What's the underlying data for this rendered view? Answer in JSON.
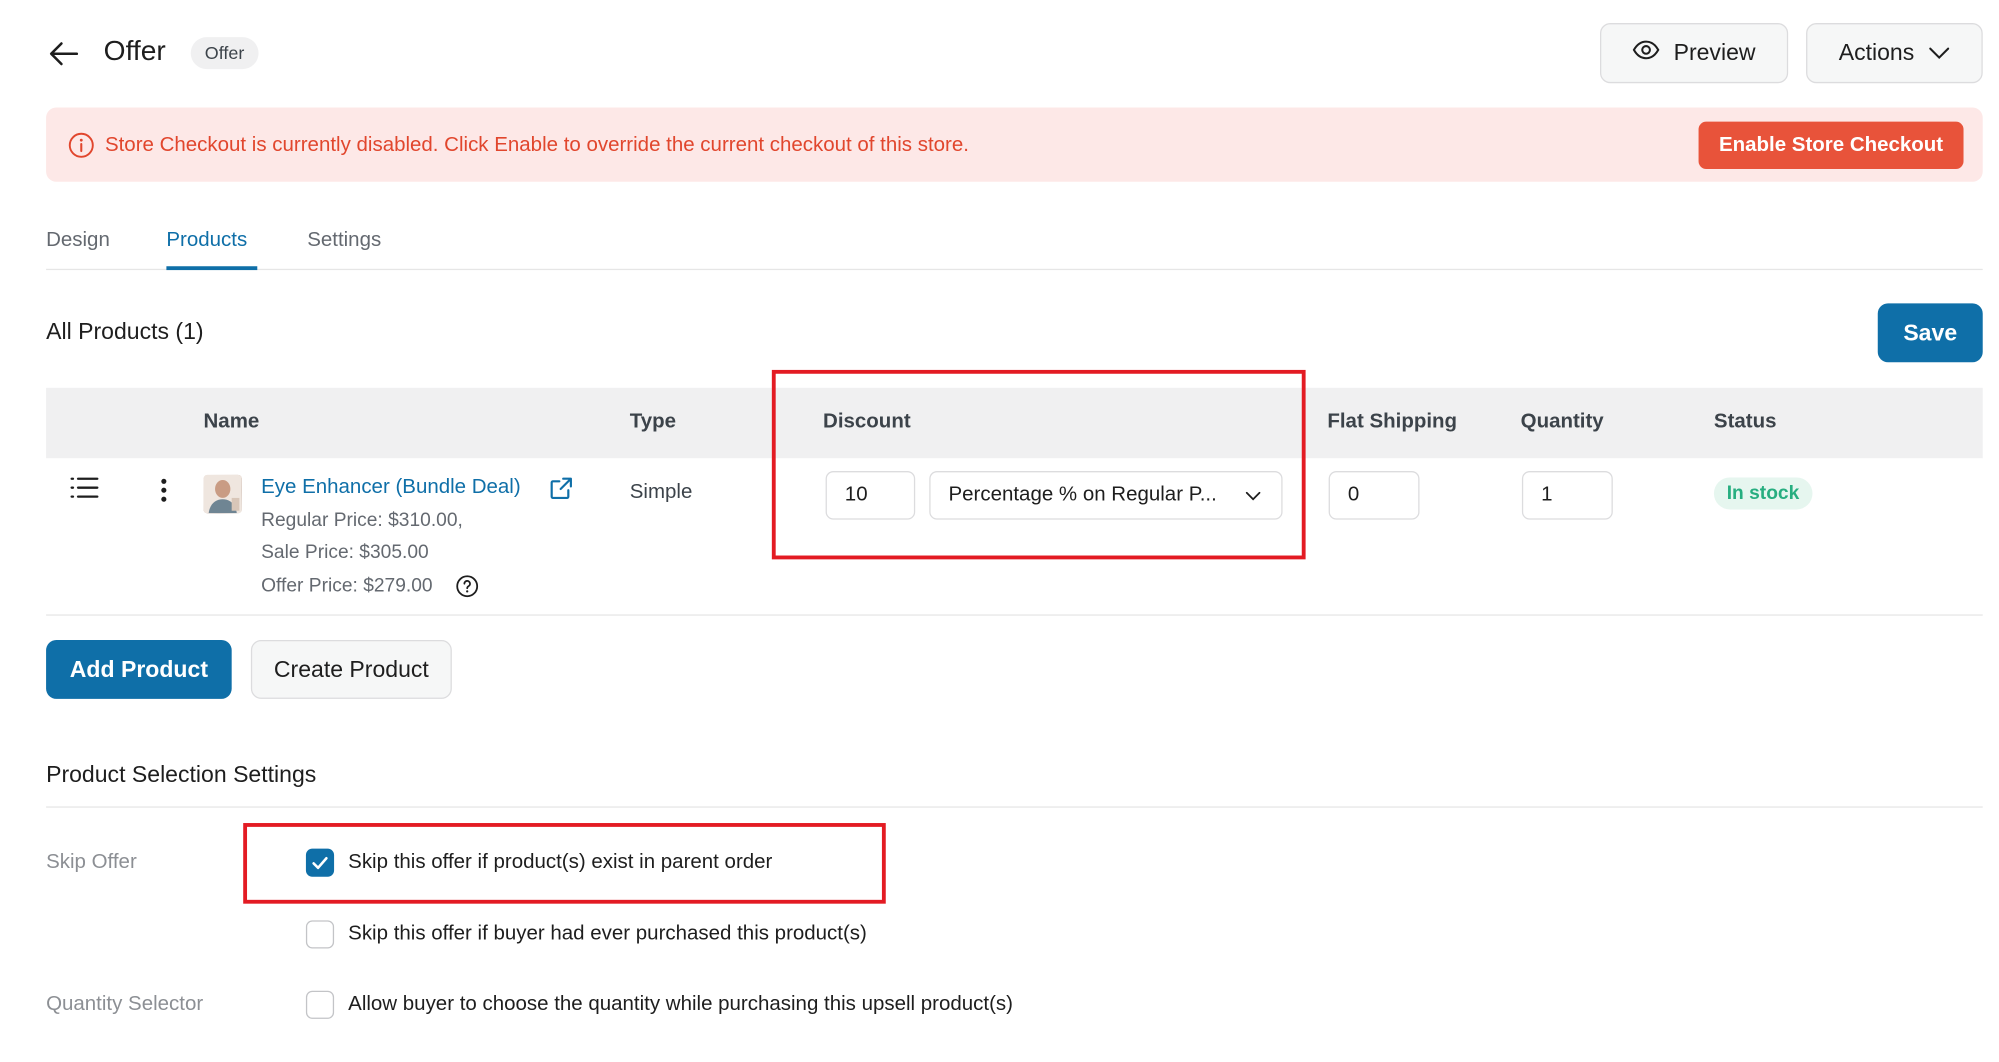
{
  "header": {
    "title": "Offer",
    "badge": "Offer",
    "preview_label": "Preview",
    "actions_label": "Actions"
  },
  "alert": {
    "message": "Store Checkout is currently disabled. Click Enable to override the current checkout of this store.",
    "button_label": "Enable Store Checkout"
  },
  "tabs": [
    {
      "label": "Design",
      "active": false
    },
    {
      "label": "Products",
      "active": true
    },
    {
      "label": "Settings",
      "active": false
    }
  ],
  "products_section": {
    "title": "All Products (1)",
    "save_label": "Save",
    "columns": {
      "name": "Name",
      "type": "Type",
      "discount": "Discount",
      "flat_shipping": "Flat Shipping",
      "quantity": "Quantity",
      "status": "Status"
    },
    "rows": [
      {
        "name": "Eye Enhancer (Bundle Deal)",
        "regular_price": "Regular Price: $310.00,",
        "sale_price": "Sale Price: $305.00",
        "offer_price": "Offer Price: $279.00",
        "type": "Simple",
        "discount_value": "10",
        "discount_type": "Percentage % on Regular P...",
        "flat_shipping": "0",
        "quantity": "1",
        "status": "In stock"
      }
    ],
    "add_product_label": "Add Product",
    "create_product_label": "Create Product"
  },
  "selection_settings": {
    "title": "Product Selection Settings",
    "skip_offer_label": "Skip Offer",
    "quantity_selector_label": "Quantity Selector",
    "options": [
      {
        "label": "Skip this offer if product(s) exist in parent order",
        "checked": true
      },
      {
        "label": "Skip this offer if buyer had ever purchased this product(s)",
        "checked": false
      },
      {
        "label": "Allow buyer to choose the quantity while purchasing this upsell product(s)",
        "checked": false
      }
    ]
  },
  "colors": {
    "primary": "#0f6fa8",
    "danger": "#e8533a",
    "alert_bg": "#fde8e7",
    "success": "#27ae80",
    "highlight": "#e31b23"
  },
  "icons": [
    "arrow-left-icon",
    "eye-icon",
    "chevron-down-icon",
    "info-circle-icon",
    "drag-handle-icon",
    "kebab-icon",
    "external-link-icon",
    "help-circle-icon",
    "check-icon"
  ]
}
